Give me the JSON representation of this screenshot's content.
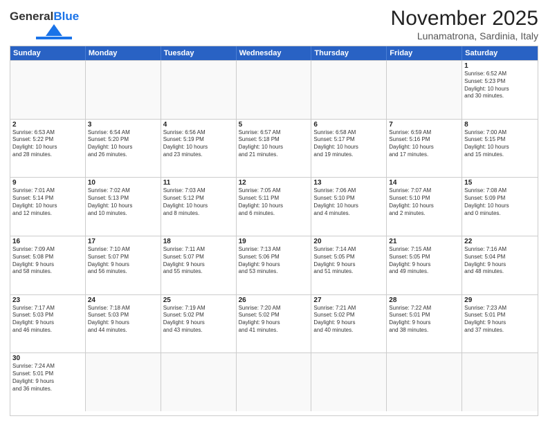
{
  "title": "November 2025",
  "subtitle": "Lunamatrona, Sardinia, Italy",
  "logo": {
    "general": "General",
    "blue": "Blue"
  },
  "weekdays": [
    "Sunday",
    "Monday",
    "Tuesday",
    "Wednesday",
    "Thursday",
    "Friday",
    "Saturday"
  ],
  "weeks": [
    [
      {
        "day": "",
        "text": ""
      },
      {
        "day": "",
        "text": ""
      },
      {
        "day": "",
        "text": ""
      },
      {
        "day": "",
        "text": ""
      },
      {
        "day": "",
        "text": ""
      },
      {
        "day": "",
        "text": ""
      },
      {
        "day": "1",
        "text": "Sunrise: 6:52 AM\nSunset: 5:23 PM\nDaylight: 10 hours\nand 30 minutes."
      }
    ],
    [
      {
        "day": "2",
        "text": "Sunrise: 6:53 AM\nSunset: 5:22 PM\nDaylight: 10 hours\nand 28 minutes."
      },
      {
        "day": "3",
        "text": "Sunrise: 6:54 AM\nSunset: 5:20 PM\nDaylight: 10 hours\nand 26 minutes."
      },
      {
        "day": "4",
        "text": "Sunrise: 6:56 AM\nSunset: 5:19 PM\nDaylight: 10 hours\nand 23 minutes."
      },
      {
        "day": "5",
        "text": "Sunrise: 6:57 AM\nSunset: 5:18 PM\nDaylight: 10 hours\nand 21 minutes."
      },
      {
        "day": "6",
        "text": "Sunrise: 6:58 AM\nSunset: 5:17 PM\nDaylight: 10 hours\nand 19 minutes."
      },
      {
        "day": "7",
        "text": "Sunrise: 6:59 AM\nSunset: 5:16 PM\nDaylight: 10 hours\nand 17 minutes."
      },
      {
        "day": "8",
        "text": "Sunrise: 7:00 AM\nSunset: 5:15 PM\nDaylight: 10 hours\nand 15 minutes."
      }
    ],
    [
      {
        "day": "9",
        "text": "Sunrise: 7:01 AM\nSunset: 5:14 PM\nDaylight: 10 hours\nand 12 minutes."
      },
      {
        "day": "10",
        "text": "Sunrise: 7:02 AM\nSunset: 5:13 PM\nDaylight: 10 hours\nand 10 minutes."
      },
      {
        "day": "11",
        "text": "Sunrise: 7:03 AM\nSunset: 5:12 PM\nDaylight: 10 hours\nand 8 minutes."
      },
      {
        "day": "12",
        "text": "Sunrise: 7:05 AM\nSunset: 5:11 PM\nDaylight: 10 hours\nand 6 minutes."
      },
      {
        "day": "13",
        "text": "Sunrise: 7:06 AM\nSunset: 5:10 PM\nDaylight: 10 hours\nand 4 minutes."
      },
      {
        "day": "14",
        "text": "Sunrise: 7:07 AM\nSunset: 5:10 PM\nDaylight: 10 hours\nand 2 minutes."
      },
      {
        "day": "15",
        "text": "Sunrise: 7:08 AM\nSunset: 5:09 PM\nDaylight: 10 hours\nand 0 minutes."
      }
    ],
    [
      {
        "day": "16",
        "text": "Sunrise: 7:09 AM\nSunset: 5:08 PM\nDaylight: 9 hours\nand 58 minutes."
      },
      {
        "day": "17",
        "text": "Sunrise: 7:10 AM\nSunset: 5:07 PM\nDaylight: 9 hours\nand 56 minutes."
      },
      {
        "day": "18",
        "text": "Sunrise: 7:11 AM\nSunset: 5:07 PM\nDaylight: 9 hours\nand 55 minutes."
      },
      {
        "day": "19",
        "text": "Sunrise: 7:13 AM\nSunset: 5:06 PM\nDaylight: 9 hours\nand 53 minutes."
      },
      {
        "day": "20",
        "text": "Sunrise: 7:14 AM\nSunset: 5:05 PM\nDaylight: 9 hours\nand 51 minutes."
      },
      {
        "day": "21",
        "text": "Sunrise: 7:15 AM\nSunset: 5:05 PM\nDaylight: 9 hours\nand 49 minutes."
      },
      {
        "day": "22",
        "text": "Sunrise: 7:16 AM\nSunset: 5:04 PM\nDaylight: 9 hours\nand 48 minutes."
      }
    ],
    [
      {
        "day": "23",
        "text": "Sunrise: 7:17 AM\nSunset: 5:03 PM\nDaylight: 9 hours\nand 46 minutes."
      },
      {
        "day": "24",
        "text": "Sunrise: 7:18 AM\nSunset: 5:03 PM\nDaylight: 9 hours\nand 44 minutes."
      },
      {
        "day": "25",
        "text": "Sunrise: 7:19 AM\nSunset: 5:02 PM\nDaylight: 9 hours\nand 43 minutes."
      },
      {
        "day": "26",
        "text": "Sunrise: 7:20 AM\nSunset: 5:02 PM\nDaylight: 9 hours\nand 41 minutes."
      },
      {
        "day": "27",
        "text": "Sunrise: 7:21 AM\nSunset: 5:02 PM\nDaylight: 9 hours\nand 40 minutes."
      },
      {
        "day": "28",
        "text": "Sunrise: 7:22 AM\nSunset: 5:01 PM\nDaylight: 9 hours\nand 38 minutes."
      },
      {
        "day": "29",
        "text": "Sunrise: 7:23 AM\nSunset: 5:01 PM\nDaylight: 9 hours\nand 37 minutes."
      }
    ],
    [
      {
        "day": "30",
        "text": "Sunrise: 7:24 AM\nSunset: 5:01 PM\nDaylight: 9 hours\nand 36 minutes."
      },
      {
        "day": "",
        "text": ""
      },
      {
        "day": "",
        "text": ""
      },
      {
        "day": "",
        "text": ""
      },
      {
        "day": "",
        "text": ""
      },
      {
        "day": "",
        "text": ""
      },
      {
        "day": "",
        "text": ""
      }
    ]
  ]
}
